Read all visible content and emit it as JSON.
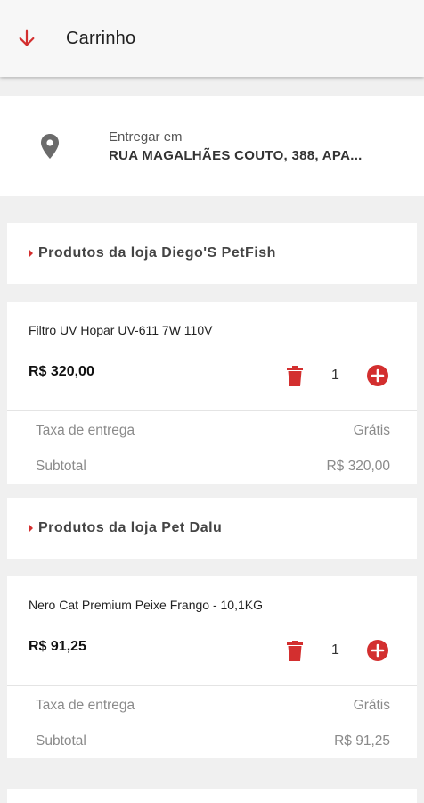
{
  "header": {
    "title": "Carrinho",
    "back_icon": "arrow-down-icon"
  },
  "address": {
    "label": "Entregar em",
    "value": "RUA MAGALHÃES COUTO, 388, APA..."
  },
  "colors": {
    "accent": "#d32f2f",
    "background": "#f0f0f0"
  },
  "stores": [
    {
      "header": "Produtos da loja Diego'S PetFish",
      "product": {
        "name": "Filtro UV Hopar UV-611 7W 110V",
        "price": "R$ 320,00",
        "quantity": "1"
      },
      "fee_label": "Taxa de entrega",
      "fee_value": "Grátis",
      "subtotal_label": "Subtotal",
      "subtotal_value": "R$ 320,00"
    },
    {
      "header": "Produtos da loja Pet Dalu",
      "product": {
        "name": "Nero Cat Premium Peixe Frango - 10,1KG",
        "price": "R$ 91,25",
        "quantity": "1"
      },
      "fee_label": "Taxa de entrega",
      "fee_value": "Grátis",
      "subtotal_label": "Subtotal",
      "subtotal_value": "R$ 91,25"
    }
  ]
}
